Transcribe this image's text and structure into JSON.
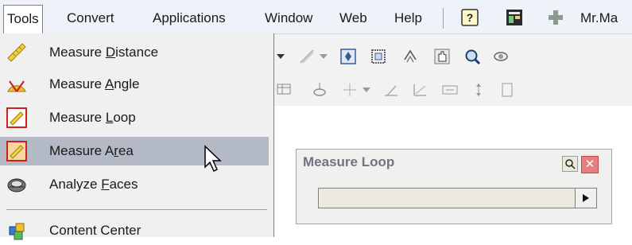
{
  "menubar": {
    "items": [
      {
        "label": "Tools",
        "active": true
      },
      {
        "label": "Convert"
      },
      {
        "label": "Applications"
      },
      {
        "label": "Window"
      },
      {
        "label": "Web"
      },
      {
        "label": "Help"
      }
    ],
    "icons": [
      "help-icon",
      "form-icon",
      "plus-icon"
    ],
    "user_label": "Mr.Ma"
  },
  "tools_menu": {
    "items": [
      {
        "label": "Measure Distance",
        "mnemonic": "D",
        "icon": "ruler-icon"
      },
      {
        "label": "Measure Angle",
        "mnemonic": "A",
        "icon": "protractor-icon"
      },
      {
        "label": "Measure Loop",
        "mnemonic": "L",
        "icon": "ruler-loop-icon"
      },
      {
        "label": "Measure Area",
        "mnemonic": "r",
        "icon": "ruler-area-icon",
        "highlighted": true
      },
      {
        "label": "Analyze Faces",
        "mnemonic": "F",
        "icon": "analyze-faces-icon"
      },
      {
        "label": "Content Center",
        "icon": "content-center-icon"
      }
    ]
  },
  "panel": {
    "title": "Measure Loop",
    "value": ""
  },
  "colors": {
    "menu_highlight": "#b4b9c6",
    "close_red": "#e77f7f",
    "panel_title": "#6f7580"
  }
}
